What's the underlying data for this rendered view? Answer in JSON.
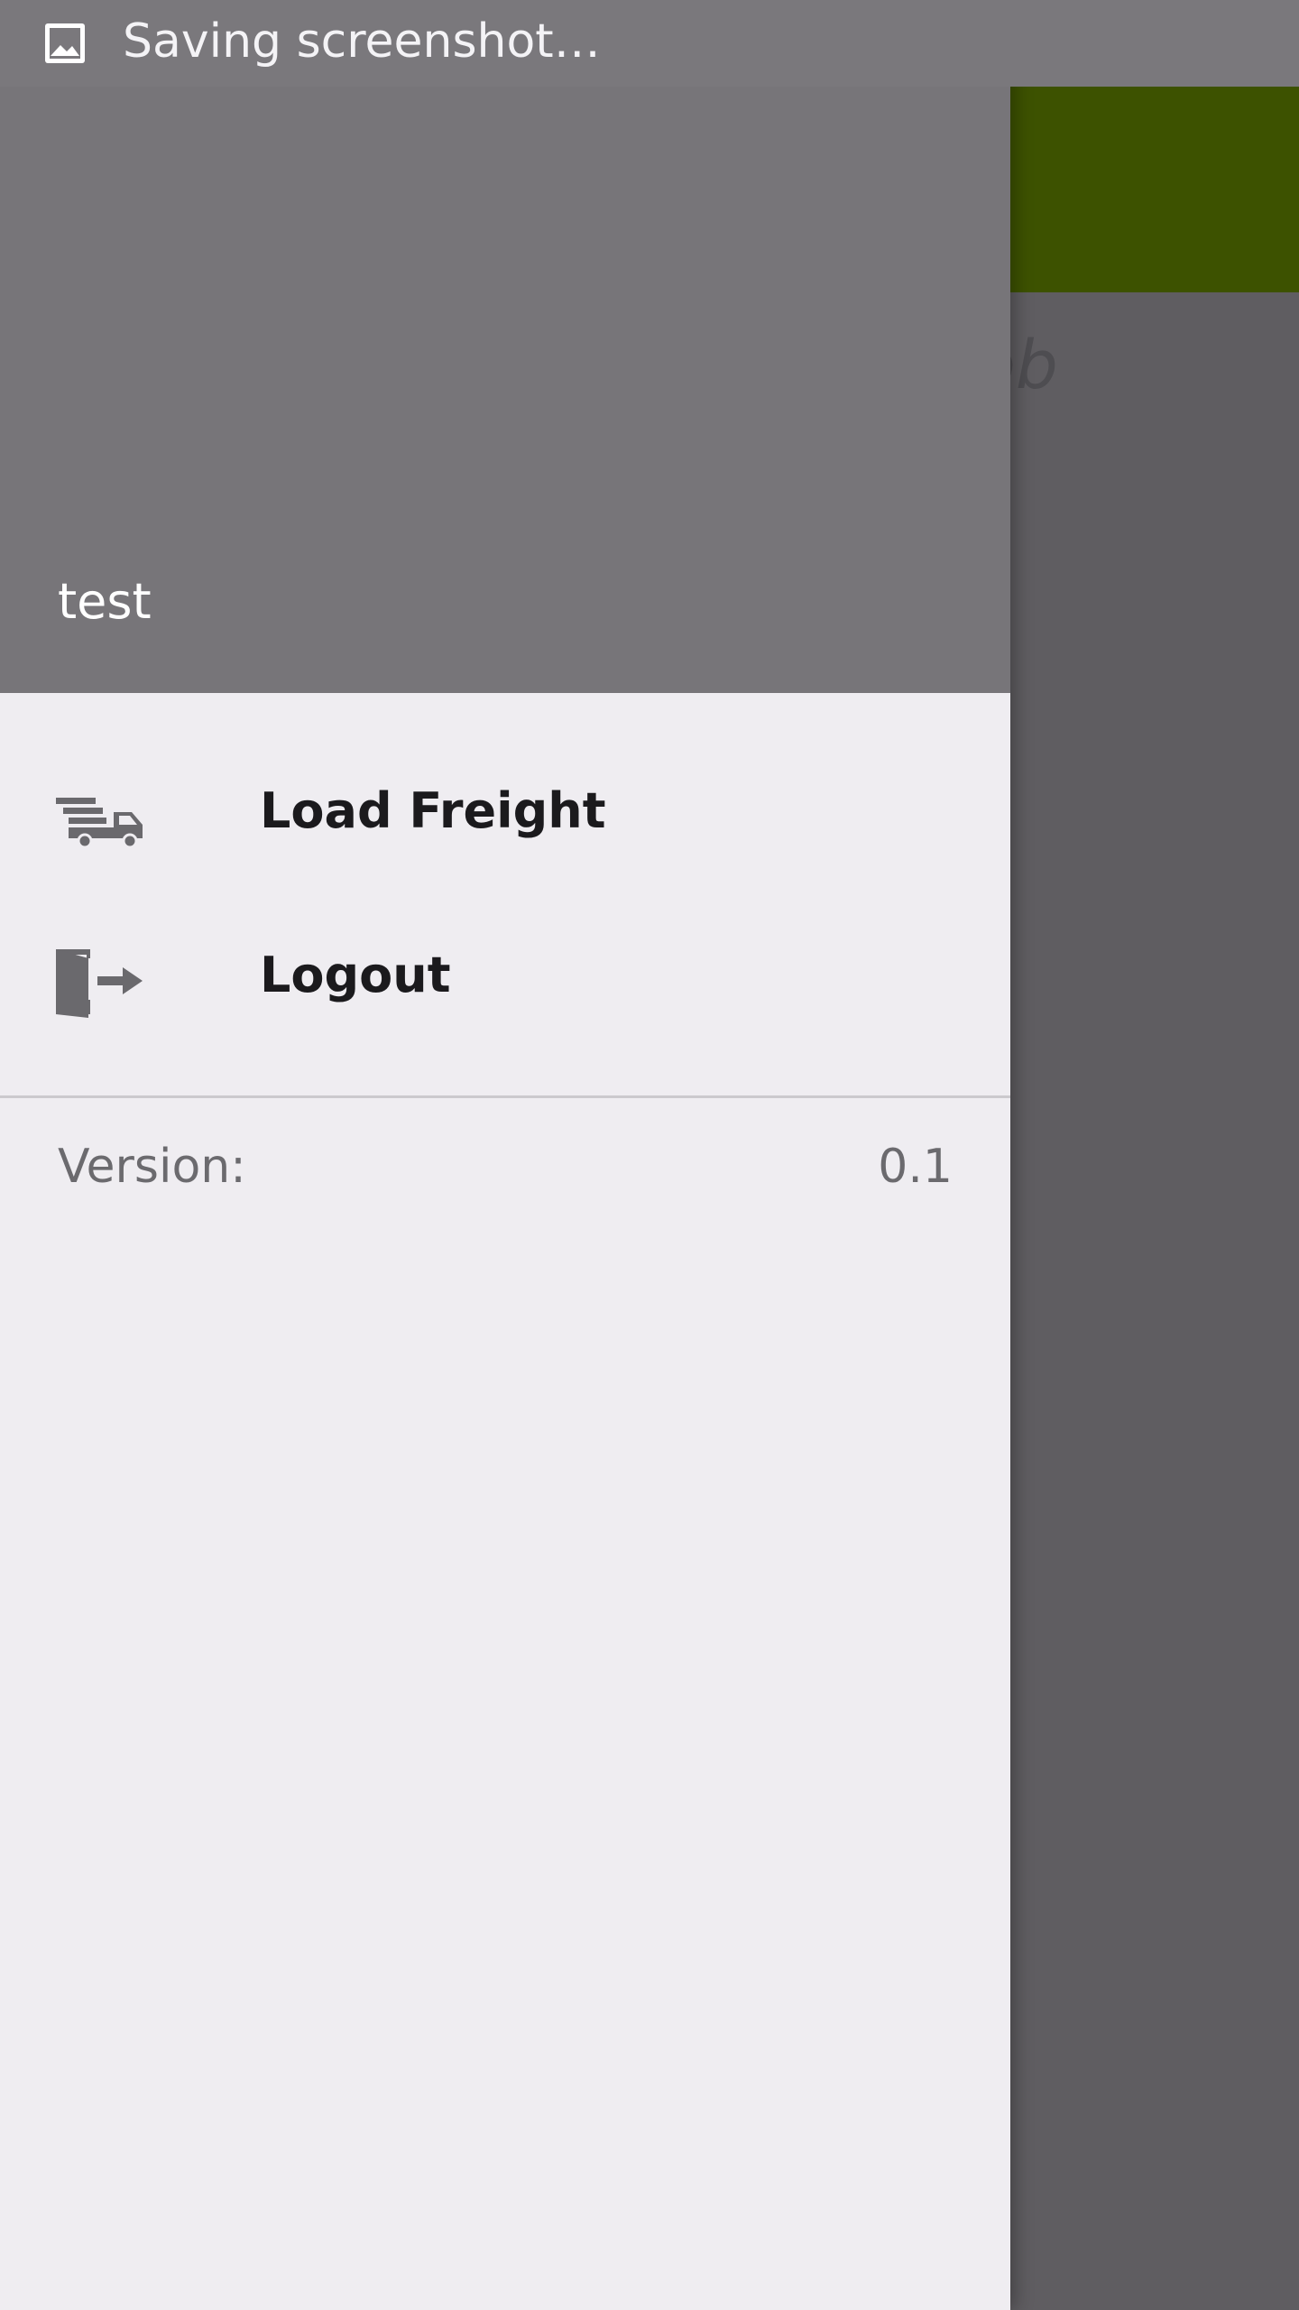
{
  "status_bar": {
    "notification_text": "Saving screenshot…",
    "icon": "image-icon"
  },
  "background_app": {
    "appbar_color": "#3d5200",
    "content_text": "job"
  },
  "drawer": {
    "header": {
      "username": "test",
      "background_color": "#777579"
    },
    "menu": [
      {
        "label": "Load Freight",
        "icon": "truck-icon"
      },
      {
        "label": "Logout",
        "icon": "logout-door-icon"
      }
    ],
    "footer": {
      "version_label": "Version:",
      "version_value": "0.1"
    }
  }
}
